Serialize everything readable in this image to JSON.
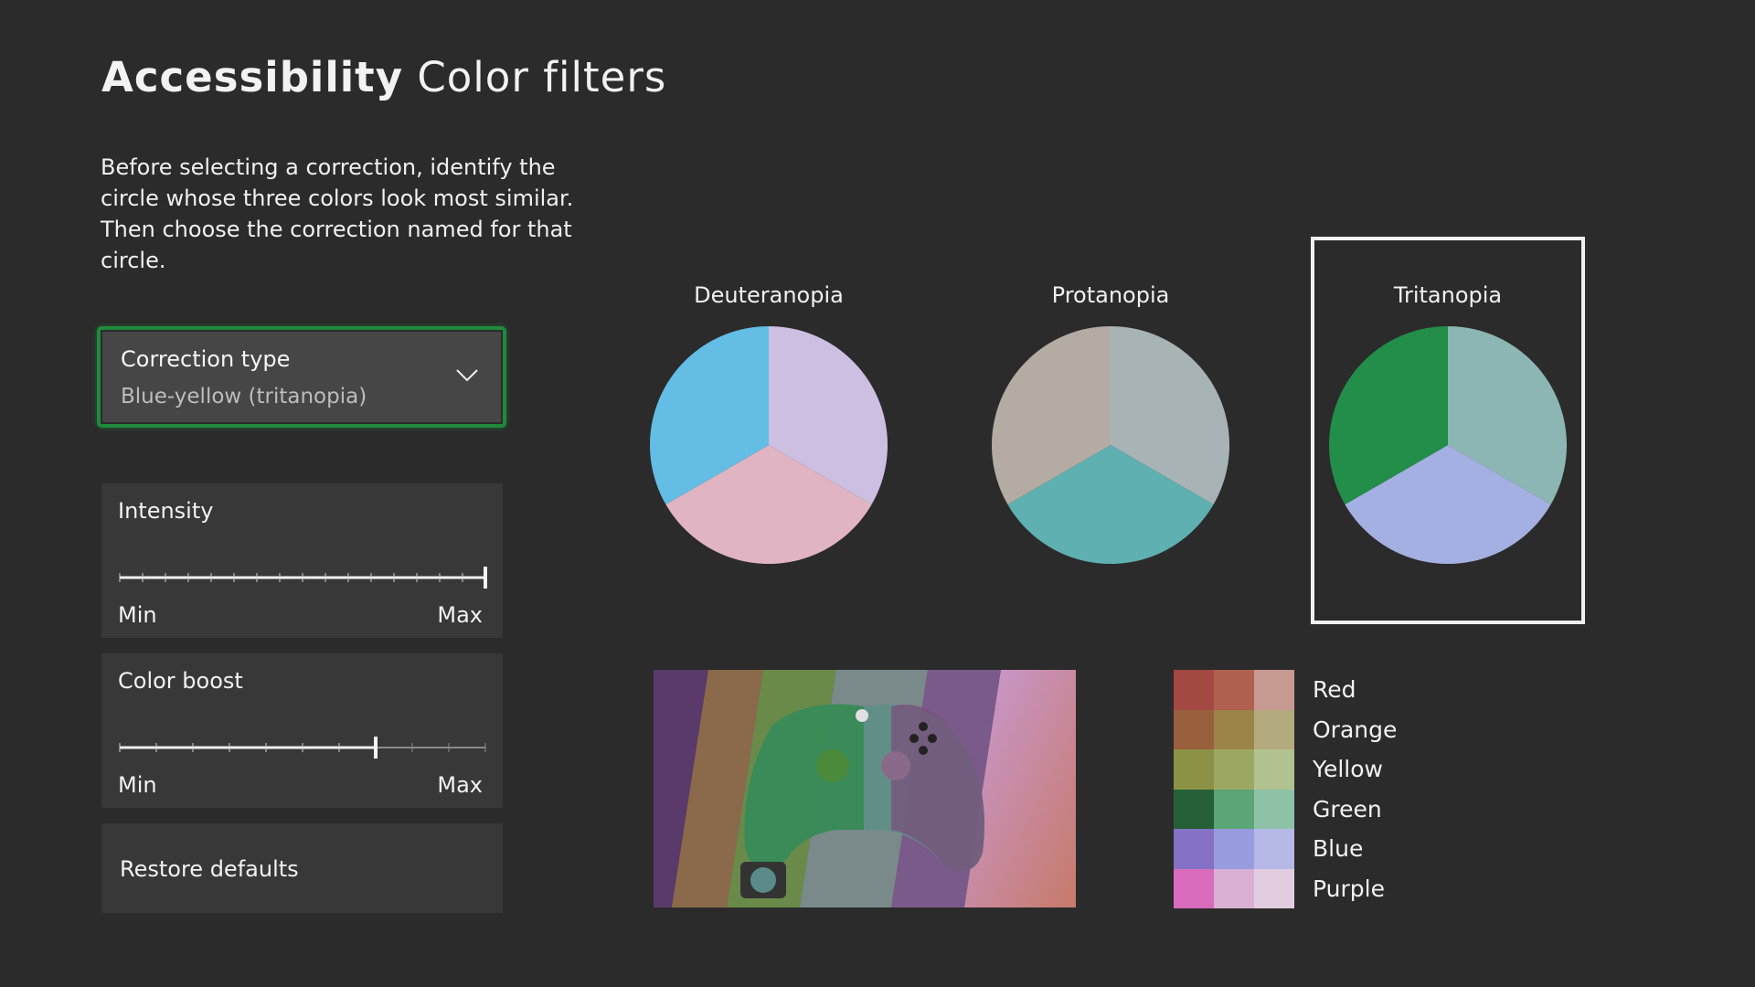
{
  "header": {
    "title_bold": "Accessibility",
    "title_rest": "Color filters"
  },
  "description": "Before selecting a correction, identify the circle whose three colors look most similar. Then choose the correction named for that circle.",
  "correction": {
    "label": "Correction type",
    "value": "Blue-yellow (tritanopia)",
    "icon": "chevron-down-icon",
    "focus_color": "#1f8a3c"
  },
  "intensity": {
    "label": "Intensity",
    "min_label": "Min",
    "max_label": "Max",
    "value": 1.0
  },
  "color_boost": {
    "label": "Color boost",
    "min_label": "Min",
    "max_label": "Max",
    "value": 0.7
  },
  "restore": {
    "label": "Restore defaults"
  },
  "circles": [
    {
      "name": "Deuteranopia",
      "colors": [
        "#ccbfe2",
        "#e0b4c2",
        "#63bde5"
      ],
      "selected": false
    },
    {
      "name": "Protanopia",
      "colors": [
        "#a8b3b6",
        "#5fb0b0",
        "#b4aba3"
      ],
      "selected": false
    },
    {
      "name": "Tritanopia",
      "colors": [
        "#8cb6b3",
        "#a4b0e2",
        "#238d4a"
      ],
      "selected": true
    }
  ],
  "preview_image": {
    "description_icon": "controller-artwork"
  },
  "swatches": [
    {
      "name": "Red",
      "colors": [
        "#a44842",
        "#b0604e",
        "#c69a90"
      ]
    },
    {
      "name": "Orange",
      "colors": [
        "#98603c",
        "#9a8448",
        "#b3aa7e"
      ]
    },
    {
      "name": "Yellow",
      "colors": [
        "#8b9246",
        "#9ca861",
        "#b1c290"
      ]
    },
    {
      "name": "Green",
      "colors": [
        "#266038",
        "#5ba576",
        "#8ec2a6"
      ]
    },
    {
      "name": "Blue",
      "colors": [
        "#8572c4",
        "#989cdf",
        "#b6b8e8"
      ]
    },
    {
      "name": "Purple",
      "colors": [
        "#d96cbd",
        "#d9b0d4",
        "#e2cde0"
      ]
    }
  ]
}
